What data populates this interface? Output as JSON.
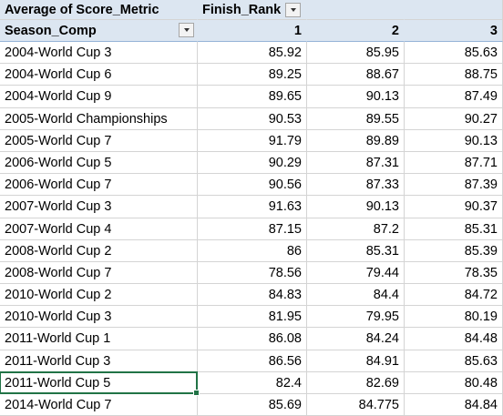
{
  "pivot": {
    "value_label": "Average of Score_Metric",
    "column_field": "Finish_Rank",
    "row_field": "Season_Comp",
    "columns": [
      "1",
      "2",
      "3"
    ],
    "rows": [
      [
        "2004-World Cup 3",
        "85.92",
        "85.95",
        "85.63"
      ],
      [
        "2004-World Cup 6",
        "89.25",
        "88.67",
        "88.75"
      ],
      [
        "2004-World Cup 9",
        "89.65",
        "90.13",
        "87.49"
      ],
      [
        "2005-World Championships",
        "90.53",
        "89.55",
        "90.27"
      ],
      [
        "2005-World Cup 7",
        "91.79",
        "89.89",
        "90.13"
      ],
      [
        "2006-World Cup 5",
        "90.29",
        "87.31",
        "87.71"
      ],
      [
        "2006-World Cup 7",
        "90.56",
        "87.33",
        "87.39"
      ],
      [
        "2007-World Cup 3",
        "91.63",
        "90.13",
        "90.37"
      ],
      [
        "2007-World Cup 4",
        "87.15",
        "87.2",
        "85.31"
      ],
      [
        "2008-World Cup 2",
        "86",
        "85.31",
        "85.39"
      ],
      [
        "2008-World Cup 7",
        "78.56",
        "79.44",
        "78.35"
      ],
      [
        "2010-World Cup 2",
        "84.83",
        "84.4",
        "84.72"
      ],
      [
        "2010-World Cup 3",
        "81.95",
        "79.95",
        "80.19"
      ],
      [
        "2011-World Cup 1",
        "86.08",
        "84.24",
        "84.48"
      ],
      [
        "2011-World Cup 3",
        "86.56",
        "84.91",
        "85.63"
      ],
      [
        "2011-World Cup 5",
        "82.4",
        "82.69",
        "80.48"
      ],
      [
        "2014-World Cup 7",
        "85.69",
        "84.775",
        "84.84"
      ]
    ],
    "selected_cell": {
      "row": 15,
      "col": 0
    }
  },
  "colors": {
    "header_fill": "#dce6f1",
    "selection": "#217346",
    "gridline": "#d4d4d4"
  }
}
